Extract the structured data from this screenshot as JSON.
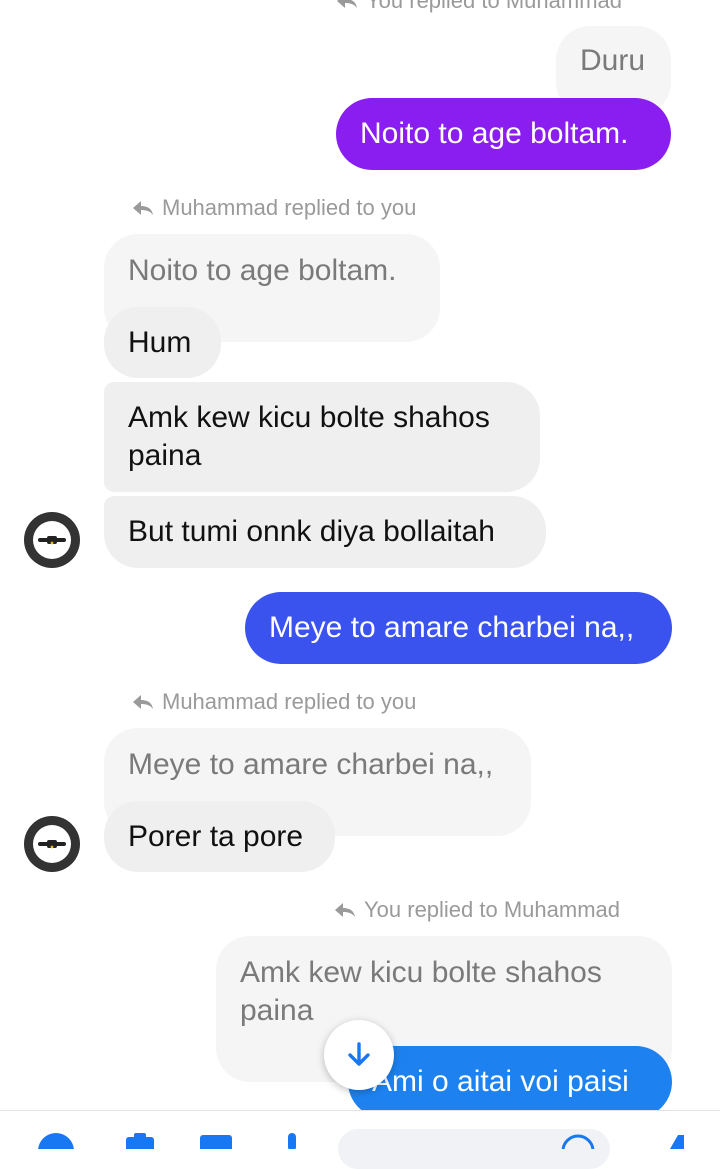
{
  "colors": {
    "outgoing_purple": "#8a1ef0",
    "outgoing_indigo": "#3a53ef",
    "outgoing_blue": "#1d82f0",
    "accent": "#1877f2"
  },
  "thread": {
    "reply_top": "You replied to Muhammad",
    "q1": "Duru",
    "m1": "Noito to age boltam.",
    "reply1": "Muhammad replied to you",
    "q2": "Noito to age boltam.",
    "m2": "Hum",
    "m3": "Amk kew kicu bolte shahos paina",
    "m4": "But tumi onnk diya bollaitah",
    "m5": "Meye to amare charbei na,,",
    "reply2": "Muhammad replied to you",
    "q3": "Meye to amare charbei na,,",
    "m6": "Porer ta pore",
    "reply3": "You replied to Muhammad",
    "q4": "Amk kew kicu bolte shahos paina",
    "m7": "Ami o aitai voi paisi"
  },
  "icons": {
    "reply": "reply-arrow-icon",
    "scroll": "arrow-down-icon",
    "avatar": "profile-avatar"
  }
}
